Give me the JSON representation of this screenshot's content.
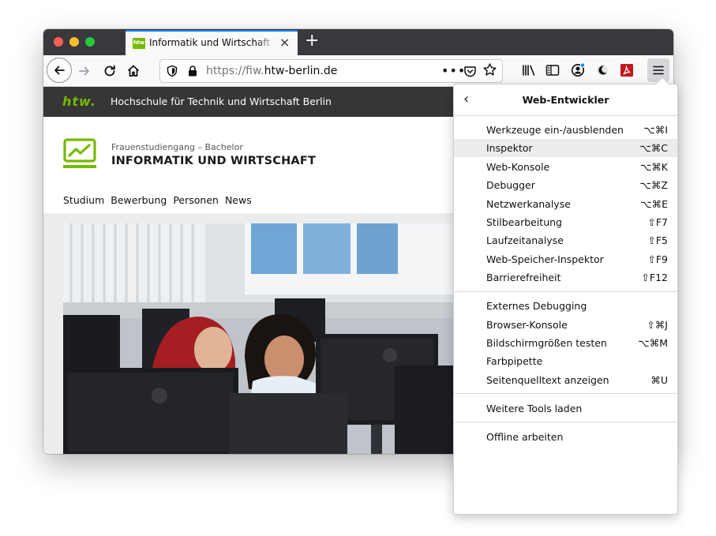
{
  "tab": {
    "title": "Informatik und Wirtschaft – Frauenstudiengang",
    "favicon_text": "htw",
    "close": "×"
  },
  "toolbar": {
    "new_tab": "+"
  },
  "url": {
    "prefix": "https://fiw.",
    "domain": "htw-berlin.de",
    "more": "•••"
  },
  "site": {
    "logo": "htw.",
    "name": "Hochschule für Technik und Wirtschaft Berlin",
    "subtitle": "Frauenstudiengang – Bachelor",
    "title": "INFORMATIK UND WIRTSCHAFT",
    "nav": [
      "Studium",
      "Bewerbung",
      "Personen",
      "News"
    ]
  },
  "panel": {
    "back": "‹",
    "title": "Web-Entwickler",
    "group1": [
      {
        "label": "Werkzeuge ein-/ausblenden",
        "shortcut": "⌥⌘I"
      },
      {
        "label": "Inspektor",
        "shortcut": "⌥⌘C",
        "highlighted": true
      },
      {
        "label": "Web-Konsole",
        "shortcut": "⌥⌘K"
      },
      {
        "label": "Debugger",
        "shortcut": "⌥⌘Z"
      },
      {
        "label": "Netzwerkanalyse",
        "shortcut": "⌥⌘E"
      },
      {
        "label": "Stilbearbeitung",
        "shortcut": "⇧F7"
      },
      {
        "label": "Laufzeitanalyse",
        "shortcut": "⇧F5"
      },
      {
        "label": "Web-Speicher-Inspektor",
        "shortcut": "⇧F9"
      },
      {
        "label": "Barrierefreiheit",
        "shortcut": "⇧F12"
      }
    ],
    "group2": [
      {
        "label": "Externes Debugging",
        "shortcut": ""
      },
      {
        "label": "Browser-Konsole",
        "shortcut": "⇧⌘J"
      },
      {
        "label": "Bildschirmgrößen testen",
        "shortcut": "⌥⌘M"
      },
      {
        "label": "Farbpipette",
        "shortcut": ""
      },
      {
        "label": "Seitenquelltext anzeigen",
        "shortcut": "⌘U"
      }
    ],
    "group3": [
      {
        "label": "Weitere Tools laden",
        "shortcut": ""
      }
    ],
    "group4": [
      {
        "label": "Offline arbeiten",
        "shortcut": ""
      }
    ]
  },
  "colors": {
    "brand_green": "#76b900",
    "accent_blue": "#0a84ff",
    "tabbar": "#38383d"
  }
}
